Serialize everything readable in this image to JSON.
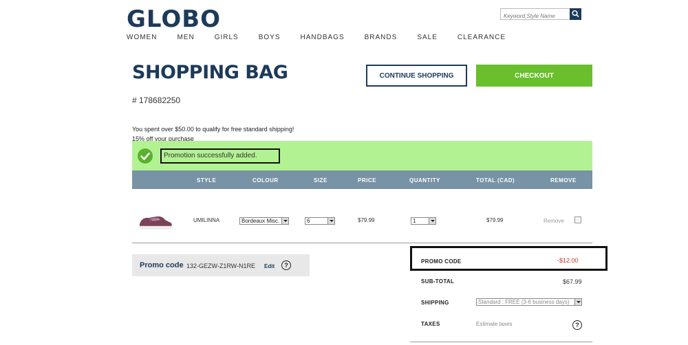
{
  "header": {
    "logo": "GLOBO",
    "search_placeholder": "Keyword,Style Name",
    "nav": [
      "WOMEN",
      "MEN",
      "GIRLS",
      "BOYS",
      "HANDBAGS",
      "BRANDS",
      "SALE",
      "CLEARANCE"
    ]
  },
  "page": {
    "title": "SHOPPING BAG",
    "order_number": "# 178682250",
    "continue_label": "CONTINUE SHOPPING",
    "checkout_label": "CHECKOUT"
  },
  "messages": {
    "shipping_msg": "You spent over $50.00 to qualify for free standard shipping!",
    "promo_desc": "15% off your purchase",
    "promo_success": "Promotion successfully added."
  },
  "table": {
    "headers": [
      "STYLE",
      "COLOUR",
      "SIZE",
      "PRICE",
      "QUANTITY",
      "TOTAL (CAD)",
      "REMOVE"
    ],
    "rows": [
      {
        "style": "UMILINNA",
        "colour": "Bordeaux Misc.",
        "size": "6",
        "price": "$79.99",
        "quantity": "1",
        "total": "$79.99",
        "remove_label": "Remove"
      }
    ]
  },
  "promo": {
    "label": "Promo code",
    "code": "132-GEZW-Z1RW-N1RE",
    "edit_label": "Edit"
  },
  "summary": {
    "promo_code_label": "PROMO CODE",
    "promo_code_value": "-$12.00",
    "subtotal_label": "SUB-TOTAL",
    "subtotal_value": "$67.99",
    "shipping_label": "SHIPPING",
    "shipping_option": "Standard : FREE (3-6 business days)",
    "taxes_label": "TAXES",
    "taxes_link": "Estimate taxes"
  },
  "colors": {
    "brand": "#1d3a5a",
    "checkout": "#6abf2c",
    "promo_banner": "#b2f293",
    "table_header": "#7893a5",
    "discount": "#c0392b"
  }
}
